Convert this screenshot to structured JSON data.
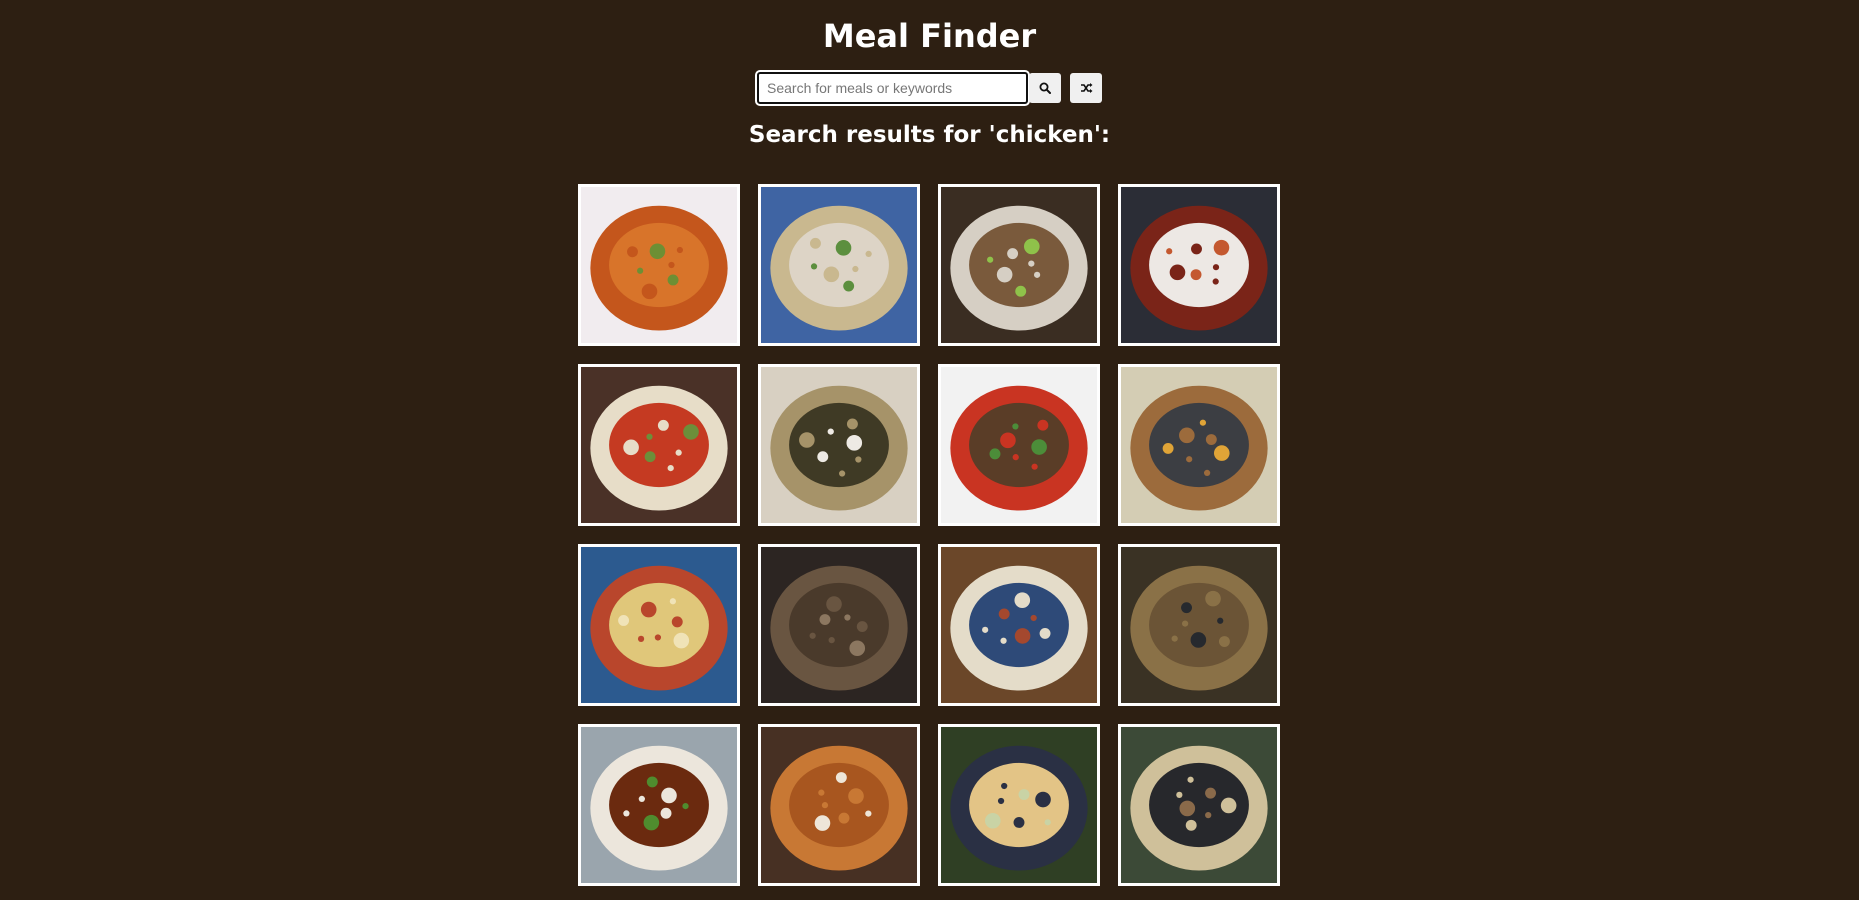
{
  "header": {
    "title": "Meal Finder"
  },
  "search": {
    "placeholder": "Search for meals or keywords",
    "value": "",
    "search_icon": "search-icon",
    "random_icon": "shuffle-icon"
  },
  "results": {
    "heading": "Search results for 'chicken':"
  },
  "meals": [
    {
      "palette": [
        "#f1ecef",
        "#d8742a",
        "#c4561c",
        "#6d8f34"
      ]
    },
    {
      "palette": [
        "#3f64a3",
        "#ddd4c6",
        "#c9b88f",
        "#5c8f3e"
      ]
    },
    {
      "palette": [
        "#3a2d22",
        "#7a5a3c",
        "#d6cfc4",
        "#8fc24a"
      ]
    },
    {
      "palette": [
        "#2b2d36",
        "#ede8e4",
        "#7a2418",
        "#c4582f"
      ]
    },
    {
      "palette": [
        "#4a3127",
        "#c53a22",
        "#e7ddc8",
        "#6c8f3a"
      ]
    },
    {
      "palette": [
        "#d8d0c2",
        "#3f3a25",
        "#a69369",
        "#eeeae4"
      ]
    },
    {
      "palette": [
        "#f2f2f2",
        "#5a3d27",
        "#c93422",
        "#4c8d39"
      ]
    },
    {
      "palette": [
        "#d4cdb4",
        "#3c3e43",
        "#9c6b3c",
        "#e0a437"
      ]
    },
    {
      "palette": [
        "#2c5a8f",
        "#e0c77a",
        "#b9462c",
        "#f0e3b7"
      ]
    },
    {
      "palette": [
        "#2c2522",
        "#4a3a2b",
        "#695541",
        "#8c7760"
      ]
    },
    {
      "palette": [
        "#6b4729",
        "#2e4a78",
        "#e4dcc9",
        "#a4482e"
      ]
    },
    {
      "palette": [
        "#3a3224",
        "#6b5436",
        "#8a7147",
        "#26292e"
      ]
    },
    {
      "palette": [
        "#9aa5ad",
        "#6b2a0f",
        "#ece6dc",
        "#4f8c2e"
      ]
    },
    {
      "palette": [
        "#473023",
        "#a8561f",
        "#c87834",
        "#eee6d8"
      ]
    },
    {
      "palette": [
        "#2f3f24",
        "#e3c486",
        "#2a3044",
        "#c9d3a5"
      ]
    },
    {
      "palette": [
        "#3c4a37",
        "#27282c",
        "#cfc09a",
        "#8a6a4a"
      ]
    }
  ]
}
